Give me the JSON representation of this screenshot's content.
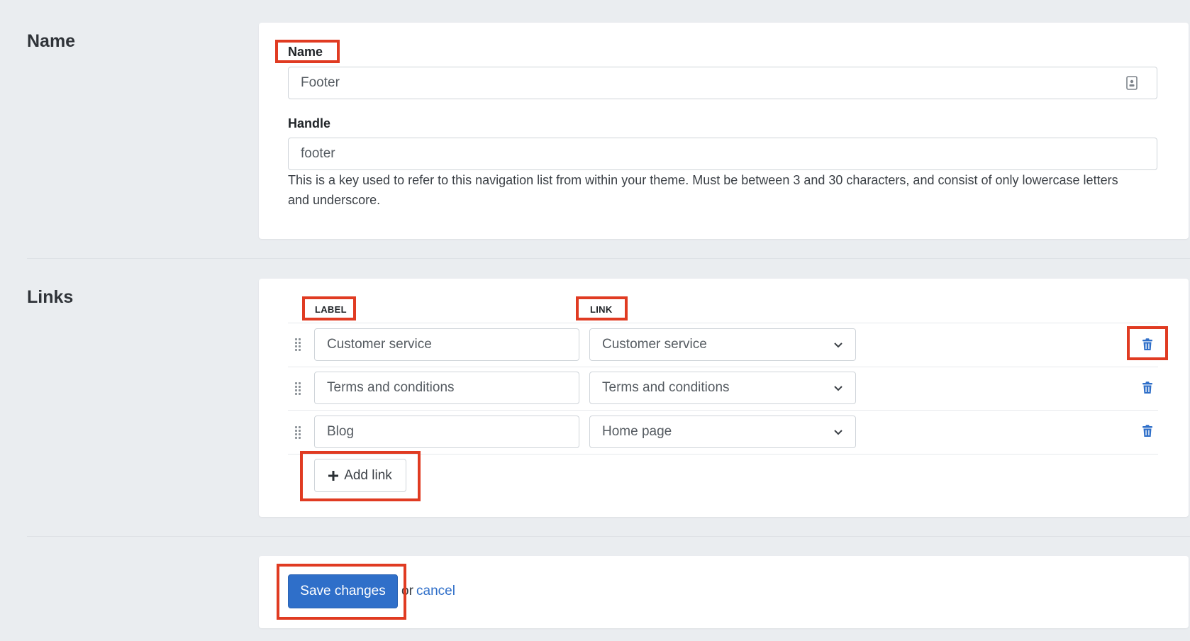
{
  "name_section": {
    "title": "Name",
    "name_label": "Name",
    "name_value": "Footer",
    "handle_label": "Handle",
    "handle_value": "footer",
    "handle_help": "This is a key used to refer to this navigation list from within your theme. Must be between 3 and 30 characters, and consist of only lowercase letters and underscore."
  },
  "links_section": {
    "title": "Links",
    "col_label": "LABEL",
    "col_link": "LINK",
    "rows": [
      {
        "label": "Customer service",
        "link": "Customer service"
      },
      {
        "label": "Terms and conditions",
        "link": "Terms and conditions"
      },
      {
        "label": "Blog",
        "link": "Home page"
      }
    ],
    "add_link": "Add link"
  },
  "actions": {
    "save": "Save changes",
    "or": "or",
    "cancel": "cancel"
  },
  "colors": {
    "accent": "#2f6fc9",
    "highlight": "#e03b22",
    "background": "#eaedf0"
  }
}
